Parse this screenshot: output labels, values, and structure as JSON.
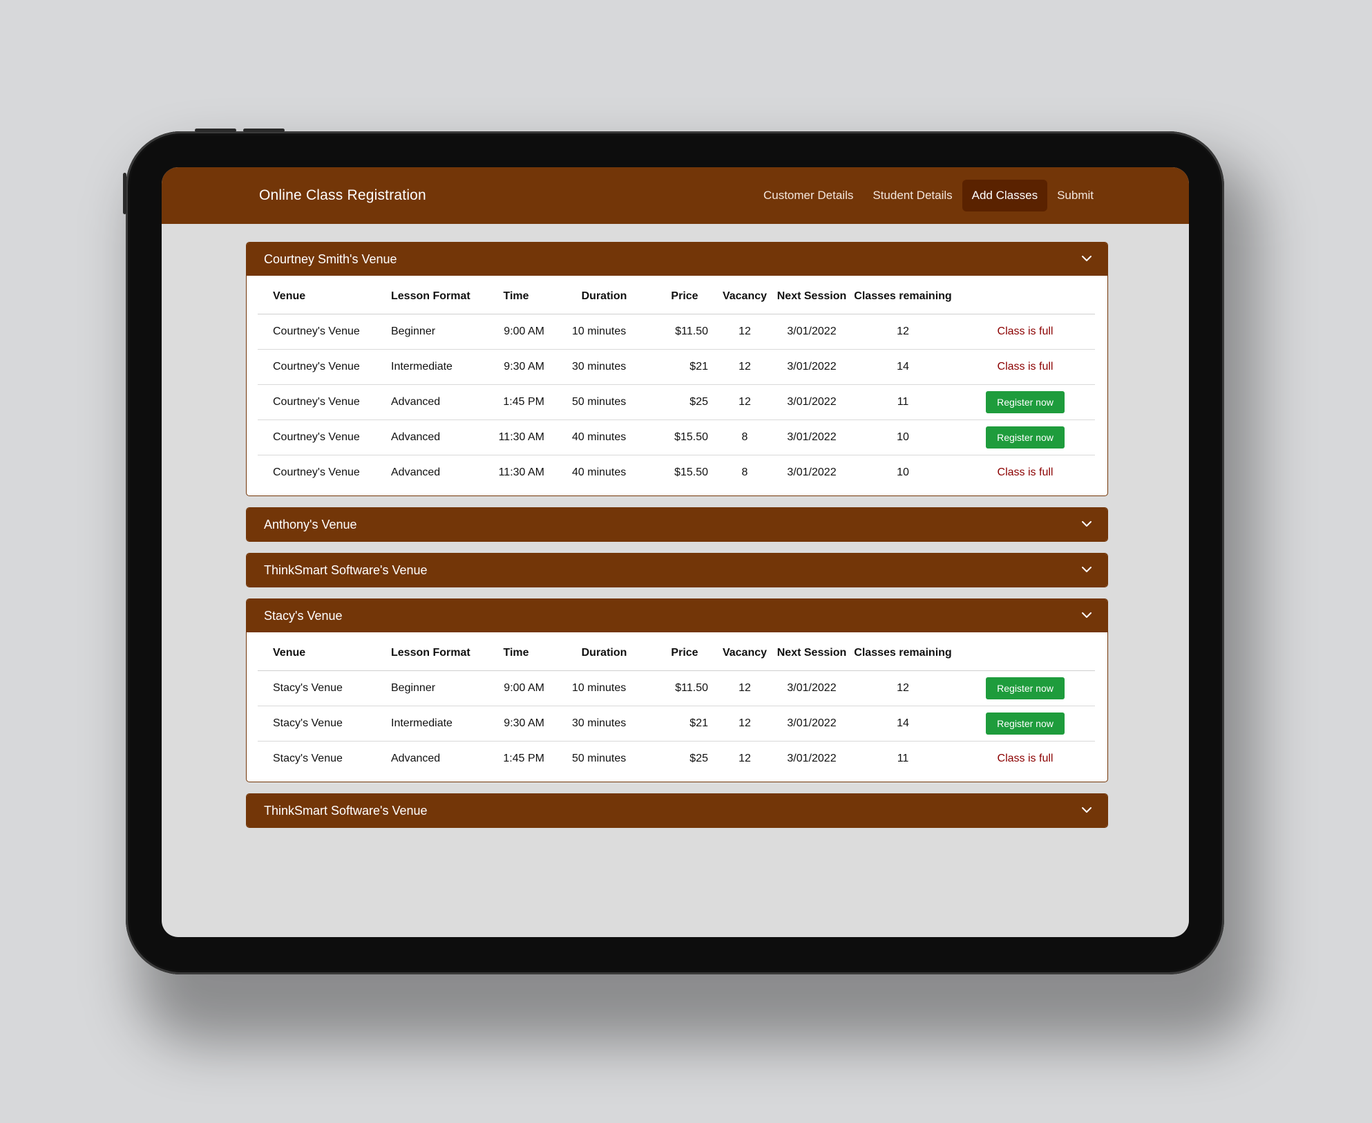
{
  "app": {
    "title": "Online Class Registration"
  },
  "nav": [
    {
      "label": "Customer Details",
      "active": false
    },
    {
      "label": "Student Details",
      "active": false
    },
    {
      "label": "Add Classes",
      "active": true
    },
    {
      "label": "Submit",
      "active": false
    }
  ],
  "columns": [
    "Venue",
    "Lesson Format",
    "Time",
    "Duration",
    "Price",
    "Vacancy",
    "Next Session",
    "Classes remaining"
  ],
  "actions": {
    "full": "Class is full",
    "register": "Register now"
  },
  "panels": [
    {
      "title": "Courtney Smith's Venue",
      "expanded": true,
      "rows": [
        {
          "venue": "Courtney's Venue",
          "format": "Beginner",
          "time": "9:00 AM",
          "duration": "10 minutes",
          "price": "$11.50",
          "vacancy": "12",
          "next": "3/01/2022",
          "remaining": "12",
          "status": "full"
        },
        {
          "venue": "Courtney's Venue",
          "format": "Intermediate",
          "time": "9:30 AM",
          "duration": "30 minutes",
          "price": "$21",
          "vacancy": "12",
          "next": "3/01/2022",
          "remaining": "14",
          "status": "full"
        },
        {
          "venue": "Courtney's Venue",
          "format": "Advanced",
          "time": "1:45 PM",
          "duration": "50 minutes",
          "price": "$25",
          "vacancy": "12",
          "next": "3/01/2022",
          "remaining": "11",
          "status": "register"
        },
        {
          "venue": "Courtney's Venue",
          "format": "Advanced",
          "time": "11:30 AM",
          "duration": "40 minutes",
          "price": "$15.50",
          "vacancy": "8",
          "next": "3/01/2022",
          "remaining": "10",
          "status": "register"
        },
        {
          "venue": "Courtney's Venue",
          "format": "Advanced",
          "time": "11:30 AM",
          "duration": "40 minutes",
          "price": "$15.50",
          "vacancy": "8",
          "next": "3/01/2022",
          "remaining": "10",
          "status": "full"
        }
      ]
    },
    {
      "title": "Anthony's Venue",
      "expanded": false,
      "rows": []
    },
    {
      "title": "ThinkSmart Software's Venue",
      "expanded": false,
      "rows": []
    },
    {
      "title": "Stacy's Venue",
      "expanded": true,
      "rows": [
        {
          "venue": "Stacy's Venue",
          "format": "Beginner",
          "time": "9:00 AM",
          "duration": "10 minutes",
          "price": "$11.50",
          "vacancy": "12",
          "next": "3/01/2022",
          "remaining": "12",
          "status": "register"
        },
        {
          "venue": "Stacy's Venue",
          "format": "Intermediate",
          "time": "9:30 AM",
          "duration": "30 minutes",
          "price": "$21",
          "vacancy": "12",
          "next": "3/01/2022",
          "remaining": "14",
          "status": "register"
        },
        {
          "venue": "Stacy's Venue",
          "format": "Advanced",
          "time": "1:45 PM",
          "duration": "50 minutes",
          "price": "$25",
          "vacancy": "12",
          "next": "3/01/2022",
          "remaining": "11",
          "status": "full"
        }
      ]
    },
    {
      "title": "ThinkSmart Software's Venue",
      "expanded": false,
      "rows": []
    }
  ]
}
